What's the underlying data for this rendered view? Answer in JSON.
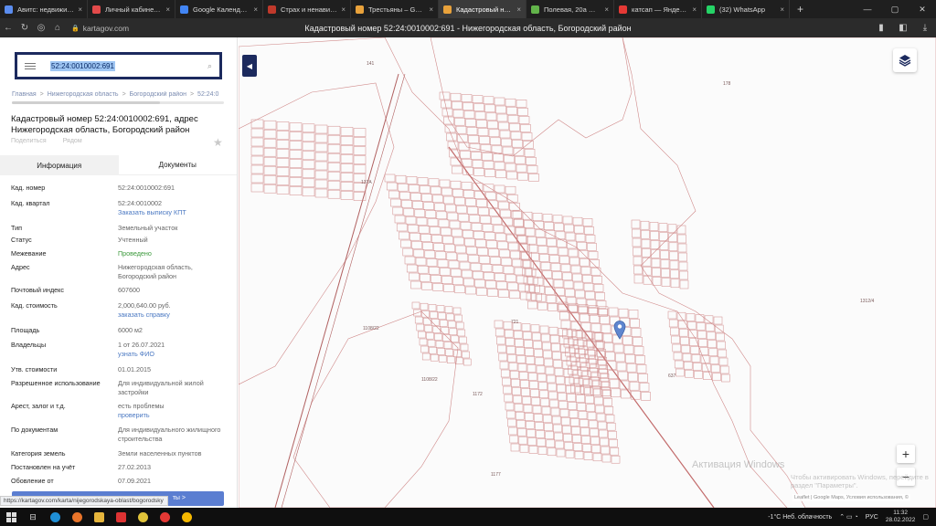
{
  "browser": {
    "tabs": [
      {
        "title": "Авитс: недвижимость",
        "color": "#5b8def"
      },
      {
        "title": "Личный кабинет - Ссо",
        "color": "#e24a4a"
      },
      {
        "title": "Google Календарь - н",
        "color": "#4285f4"
      },
      {
        "title": "Страх и ненависть в Л",
        "color": "#c0392b"
      },
      {
        "title": "Трестьяны – Google К",
        "color": "#e9a23b"
      },
      {
        "title": "Кадастровый номер",
        "color": "#e9a23b",
        "active": true
      },
      {
        "title": "Полевая, 20а — 2ГИС",
        "color": "#62b34a"
      },
      {
        "title": "катсап — Яндекс: наш",
        "color": "#e53935"
      },
      {
        "title": "(32) WhatsApp",
        "color": "#25d366"
      }
    ],
    "url": "kartagov.com",
    "page_title": "Кадастровый номер 52:24:0010002:691 - Нижегородская область, Богородский район"
  },
  "sidebar": {
    "search_value": "52:24:0010002:691",
    "breadcrumbs": [
      "Главная",
      "Нижегородская область",
      "Богородский район",
      "52:24:0"
    ],
    "title": "Кадастровый номер 52:24:0010002:691, адрес Нижегородская область, Богородский район",
    "subtabs": [
      "Поделиться",
      "Рядом"
    ],
    "tabs": {
      "info": "Информация",
      "docs": "Документы"
    },
    "props": [
      {
        "k": "Кад. номер",
        "v": "52:24:0010002:691"
      },
      {
        "k": "Кад. квартал",
        "v": "52:24:0010002",
        "link": "Заказать выписку КПТ"
      },
      {
        "k": "Тип",
        "v": "Земельный участок"
      },
      {
        "k": "Статус",
        "v": "Учтенный"
      },
      {
        "k": "Межевание",
        "v": "Проведено",
        "green": true
      },
      {
        "k": "Адрес",
        "v": "Нижегородская область, Богородский район"
      },
      {
        "k": "Почтовый индекс",
        "v": "607600"
      },
      {
        "k": "Кад. стоимость",
        "v": "2,000,640.00 руб.",
        "link": "заказать справку"
      },
      {
        "k": "Площадь",
        "v": "6000 м2"
      },
      {
        "k": "Владельцы",
        "v": "1 от 26.07.2021",
        "link": "узнать ФИО"
      },
      {
        "k": "Утв. стоимости",
        "v": "01.01.2015"
      },
      {
        "k": "Разрешенное использование",
        "v": "Для индивидуальной жилой застройки"
      },
      {
        "k": "Арест, залог и т.д.",
        "v": "есть проблемы",
        "link": "проверить"
      },
      {
        "k": "По документам",
        "v": "Для индивидуального жилищного строительства"
      },
      {
        "k": "Категория земель",
        "v": "Земли населенных пунктов"
      },
      {
        "k": "Постановлен на учёт",
        "v": "27.02.2013"
      },
      {
        "k": "Обовление от",
        "v": "07.09.2021"
      }
    ],
    "cta_label": "ты >",
    "status_url": "https://kartagov.com/karta/nijegorodskaya-oblast/bogorodsky"
  },
  "map": {
    "labels": [
      "141",
      "178",
      "137А",
      "1108/22",
      "1108/22",
      "1172",
      "1177",
      "1312/4",
      "721",
      "637"
    ],
    "zoom_in": "+",
    "zoom_out": "−",
    "watermark_title": "Активация Windows",
    "watermark_sub": "Чтобы активировать Windows, перейдите в раздел \"Параметры\".",
    "attribution": "Leaflet | Google Maps, Условия использования, ©"
  },
  "taskbar": {
    "weather": "-1°C  Неб. облачность",
    "lang": "РУС",
    "time": "11:32",
    "date": "28.02.2022"
  }
}
